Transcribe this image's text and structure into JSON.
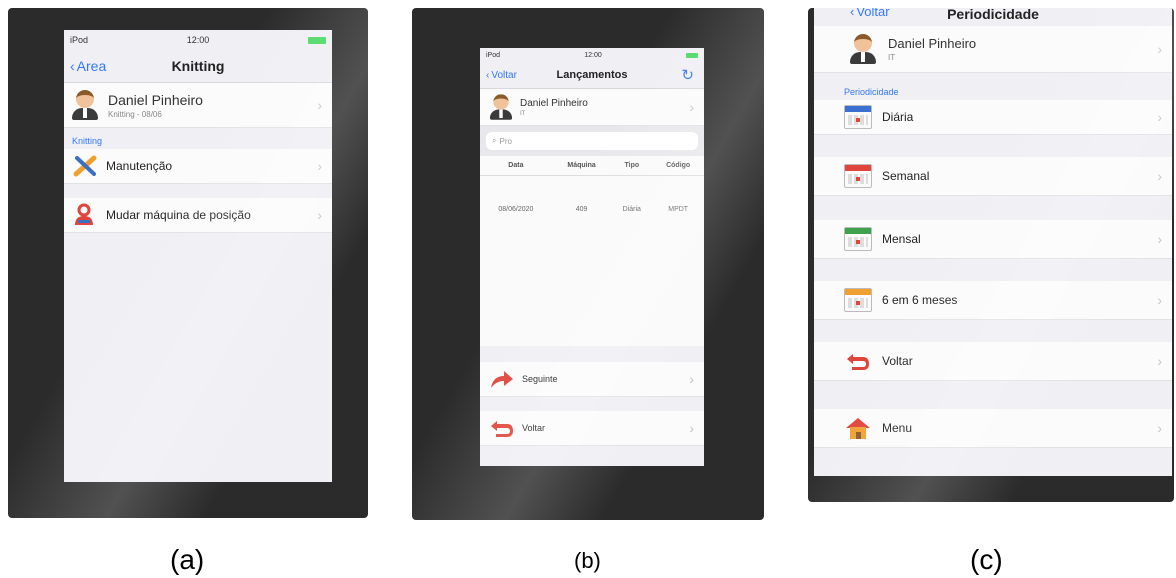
{
  "panel_a": {
    "caption": "(a)",
    "status": {
      "carrier": "iPod",
      "time": "12:00"
    },
    "nav": {
      "back": "Area",
      "title": "Knitting"
    },
    "user": {
      "name": "Daniel Pinheiro",
      "sub": "Knitting - 08/06"
    },
    "section": "Knitting",
    "items": [
      {
        "label": "Manutenção",
        "icon": "tools-icon"
      },
      {
        "label": "Mudar máquina de posição",
        "icon": "user-location-icon"
      }
    ]
  },
  "panel_b": {
    "caption": "(b)",
    "status": {
      "carrier": "iPod",
      "time": "12:00"
    },
    "nav": {
      "back": "Voltar",
      "title": "Lançamentos"
    },
    "user": {
      "name": "Daniel Pinheiro",
      "sub": "IT"
    },
    "search_placeholder": "Pro",
    "table": {
      "headers": [
        "Data",
        "Máquina",
        "Tipo",
        "Código"
      ],
      "rows": [
        [
          "08/06/2020",
          "409",
          "Diária",
          "MPDT"
        ]
      ]
    },
    "items": [
      {
        "label": "Seguinte",
        "icon": "forward-arrow-icon"
      },
      {
        "label": "Voltar",
        "icon": "back-arrow-icon"
      }
    ]
  },
  "panel_c": {
    "caption": "(c)",
    "nav": {
      "back": "Voltar",
      "title": "Periodicidade"
    },
    "user": {
      "name": "Daniel Pinheiro",
      "sub": "IT"
    },
    "section": "Periodicidade",
    "items": [
      {
        "label": "Diária",
        "color": "#3b6fd1"
      },
      {
        "label": "Semanal",
        "color": "#e0443a"
      },
      {
        "label": "Mensal",
        "color": "#3fa34d"
      },
      {
        "label": "6 em 6 meses",
        "color": "#f0a030"
      },
      {
        "label": "Voltar",
        "icon": "back-arrow-icon"
      },
      {
        "label": "Menu",
        "icon": "home-icon"
      }
    ]
  }
}
